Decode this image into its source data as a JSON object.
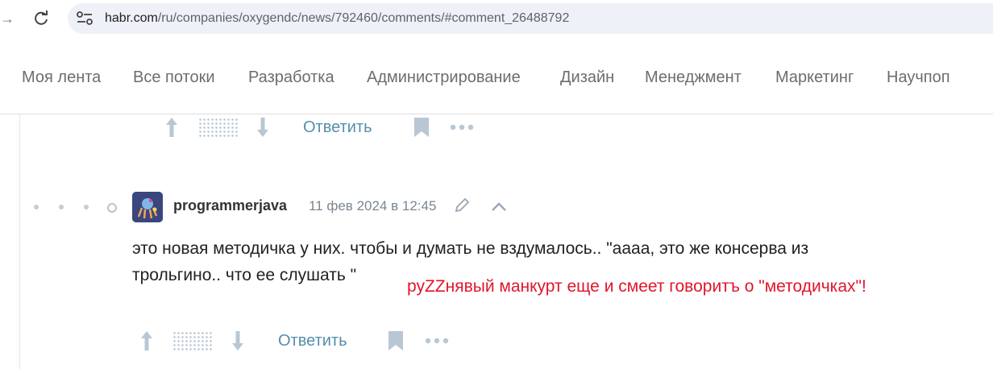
{
  "browser": {
    "url_host": "habr.com",
    "url_path": "/ru/companies/oxygendc/news/792460/comments/#comment_26488792"
  },
  "habr_nav": {
    "items": [
      "Моя лента",
      "Все потоки",
      "Разработка",
      "Администрирование",
      "Дизайн",
      "Менеджмент",
      "Маркетинг",
      "Научпоп"
    ]
  },
  "prev_comment_actions": {
    "reply_label": "Ответить"
  },
  "comment": {
    "username": "programmerjava",
    "date": "11 фев 2024 в 12:45",
    "text_line1": "это новая методичка у них. чтобы и думать не вздумалось.. \"аааа, это же консерва из",
    "text_line2": "трольгино.. что ее слушать \"",
    "reply_label": "Ответить"
  },
  "annotation": {
    "text": "руZZнявый манкурт еще и смеет говоритъ о \"методичках\"!",
    "color": "#e0162b"
  },
  "colors": {
    "accent": "#548eaa",
    "icon_gray": "#b8c7d3"
  }
}
